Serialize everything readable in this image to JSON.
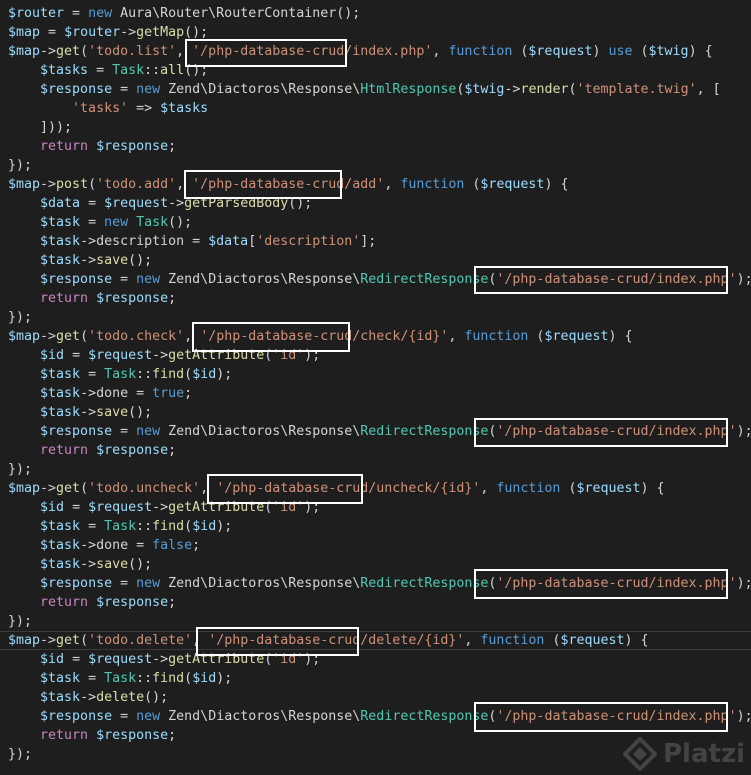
{
  "colors": {
    "background": "#1e1e1e",
    "variable": "#9cdcfe",
    "text": "#d4d4d4",
    "keyword": "#569cd6",
    "function": "#dcdcaa",
    "string": "#ce9178",
    "class": "#4ec9b0",
    "control": "#c586c0",
    "highlight_box": "#ffffff"
  },
  "watermark": {
    "icon": "platzi-logo-icon",
    "text": "Platzi"
  },
  "lines": [
    [
      [
        "var",
        "$router"
      ],
      [
        "txt",
        " = "
      ],
      [
        "kw",
        "new"
      ],
      [
        "txt",
        " Aura\\Router\\RouterContainer();"
      ]
    ],
    [
      [
        "var",
        "$map"
      ],
      [
        "txt",
        " = "
      ],
      [
        "var",
        "$router"
      ],
      [
        "txt",
        "->"
      ],
      [
        "fn",
        "getMap"
      ],
      [
        "txt",
        "();"
      ]
    ],
    [
      [
        "var",
        "$map"
      ],
      [
        "txt",
        "->"
      ],
      [
        "fn",
        "get"
      ],
      [
        "txt",
        "("
      ],
      [
        "str",
        "'todo.list'"
      ],
      [
        "txt",
        ", "
      ],
      [
        "str",
        "'/php-database-crud/index.php'"
      ],
      [
        "txt",
        ", "
      ],
      [
        "kw",
        "function"
      ],
      [
        "txt",
        " ("
      ],
      [
        "var",
        "$request"
      ],
      [
        "txt",
        ") "
      ],
      [
        "kw",
        "use"
      ],
      [
        "txt",
        " ("
      ],
      [
        "var",
        "$twig"
      ],
      [
        "txt",
        ") {"
      ]
    ],
    [
      [
        "txt",
        "    "
      ],
      [
        "var",
        "$tasks"
      ],
      [
        "txt",
        " = "
      ],
      [
        "cls",
        "Task"
      ],
      [
        "txt",
        "::"
      ],
      [
        "fn",
        "all"
      ],
      [
        "txt",
        "();"
      ]
    ],
    [
      [
        "txt",
        "    "
      ],
      [
        "var",
        "$response"
      ],
      [
        "txt",
        " = "
      ],
      [
        "kw",
        "new"
      ],
      [
        "txt",
        " Zend\\Diactoros\\Response\\"
      ],
      [
        "cls",
        "HtmlResponse"
      ],
      [
        "txt",
        "("
      ],
      [
        "var",
        "$twig"
      ],
      [
        "txt",
        "->"
      ],
      [
        "fn",
        "render"
      ],
      [
        "txt",
        "("
      ],
      [
        "str",
        "'template.twig'"
      ],
      [
        "txt",
        ", ["
      ]
    ],
    [
      [
        "txt",
        "        "
      ],
      [
        "str",
        "'tasks'"
      ],
      [
        "txt",
        " => "
      ],
      [
        "var",
        "$tasks"
      ]
    ],
    [
      [
        "txt",
        "    ]));"
      ]
    ],
    [
      [
        "txt",
        "    "
      ],
      [
        "ctl",
        "return"
      ],
      [
        "txt",
        " "
      ],
      [
        "var",
        "$response"
      ],
      [
        "txt",
        ";"
      ]
    ],
    [
      [
        "txt",
        "});"
      ]
    ],
    [
      [
        "var",
        "$map"
      ],
      [
        "txt",
        "->"
      ],
      [
        "fn",
        "post"
      ],
      [
        "txt",
        "("
      ],
      [
        "str",
        "'todo.add'"
      ],
      [
        "txt",
        ", "
      ],
      [
        "str",
        "'/php-database-crud/add'"
      ],
      [
        "txt",
        ", "
      ],
      [
        "kw",
        "function"
      ],
      [
        "txt",
        " ("
      ],
      [
        "var",
        "$request"
      ],
      [
        "txt",
        ") {"
      ]
    ],
    [
      [
        "txt",
        "    "
      ],
      [
        "var",
        "$data"
      ],
      [
        "txt",
        " = "
      ],
      [
        "var",
        "$request"
      ],
      [
        "txt",
        "->"
      ],
      [
        "fn",
        "getParsedBody"
      ],
      [
        "txt",
        "();"
      ]
    ],
    [
      [
        "txt",
        "    "
      ],
      [
        "var",
        "$task"
      ],
      [
        "txt",
        " = "
      ],
      [
        "kw",
        "new"
      ],
      [
        "txt",
        " "
      ],
      [
        "cls",
        "Task"
      ],
      [
        "txt",
        "();"
      ]
    ],
    [
      [
        "txt",
        "    "
      ],
      [
        "var",
        "$task"
      ],
      [
        "txt",
        "->description = "
      ],
      [
        "var",
        "$data"
      ],
      [
        "txt",
        "["
      ],
      [
        "str",
        "'description'"
      ],
      [
        "txt",
        "];"
      ]
    ],
    [
      [
        "txt",
        "    "
      ],
      [
        "var",
        "$task"
      ],
      [
        "txt",
        "->"
      ],
      [
        "fn",
        "save"
      ],
      [
        "txt",
        "();"
      ]
    ],
    [
      [
        "txt",
        "    "
      ],
      [
        "var",
        "$response"
      ],
      [
        "txt",
        " = "
      ],
      [
        "kw",
        "new"
      ],
      [
        "txt",
        " Zend\\Diactoros\\Response\\"
      ],
      [
        "cls",
        "RedirectResponse"
      ],
      [
        "txt",
        "("
      ],
      [
        "str",
        "'/php-database-crud/index.php'"
      ],
      [
        "txt",
        ");"
      ]
    ],
    [
      [
        "txt",
        "    "
      ],
      [
        "ctl",
        "return"
      ],
      [
        "txt",
        " "
      ],
      [
        "var",
        "$response"
      ],
      [
        "txt",
        ";"
      ]
    ],
    [
      [
        "txt",
        "});"
      ]
    ],
    [
      [
        "var",
        "$map"
      ],
      [
        "txt",
        "->"
      ],
      [
        "fn",
        "get"
      ],
      [
        "txt",
        "("
      ],
      [
        "str",
        "'todo.check'"
      ],
      [
        "txt",
        ", "
      ],
      [
        "str",
        "'/php-database-crud/check/{id}'"
      ],
      [
        "txt",
        ", "
      ],
      [
        "kw",
        "function"
      ],
      [
        "txt",
        " ("
      ],
      [
        "var",
        "$request"
      ],
      [
        "txt",
        ") {"
      ]
    ],
    [
      [
        "txt",
        "    "
      ],
      [
        "var",
        "$id"
      ],
      [
        "txt",
        " = "
      ],
      [
        "var",
        "$request"
      ],
      [
        "txt",
        "->"
      ],
      [
        "fn",
        "getAttribute"
      ],
      [
        "txt",
        "("
      ],
      [
        "str",
        "'id'"
      ],
      [
        "txt",
        ");"
      ]
    ],
    [
      [
        "txt",
        "    "
      ],
      [
        "var",
        "$task"
      ],
      [
        "txt",
        " = "
      ],
      [
        "cls",
        "Task"
      ],
      [
        "txt",
        "::"
      ],
      [
        "fn",
        "find"
      ],
      [
        "txt",
        "("
      ],
      [
        "var",
        "$id"
      ],
      [
        "txt",
        ");"
      ]
    ],
    [
      [
        "txt",
        "    "
      ],
      [
        "var",
        "$task"
      ],
      [
        "txt",
        "->done = "
      ],
      [
        "kw",
        "true"
      ],
      [
        "txt",
        ";"
      ]
    ],
    [
      [
        "txt",
        "    "
      ],
      [
        "var",
        "$task"
      ],
      [
        "txt",
        "->"
      ],
      [
        "fn",
        "save"
      ],
      [
        "txt",
        "();"
      ]
    ],
    [
      [
        "txt",
        "    "
      ],
      [
        "var",
        "$response"
      ],
      [
        "txt",
        " = "
      ],
      [
        "kw",
        "new"
      ],
      [
        "txt",
        " Zend\\Diactoros\\Response\\"
      ],
      [
        "cls",
        "RedirectResponse"
      ],
      [
        "txt",
        "("
      ],
      [
        "str",
        "'/php-database-crud/index.php'"
      ],
      [
        "txt",
        ");"
      ]
    ],
    [
      [
        "txt",
        "    "
      ],
      [
        "ctl",
        "return"
      ],
      [
        "txt",
        " "
      ],
      [
        "var",
        "$response"
      ],
      [
        "txt",
        ";"
      ]
    ],
    [
      [
        "txt",
        "});"
      ]
    ],
    [
      [
        "var",
        "$map"
      ],
      [
        "txt",
        "->"
      ],
      [
        "fn",
        "get"
      ],
      [
        "txt",
        "("
      ],
      [
        "str",
        "'todo.uncheck'"
      ],
      [
        "txt",
        ", "
      ],
      [
        "str",
        "'/php-database-crud/uncheck/{id}'"
      ],
      [
        "txt",
        ", "
      ],
      [
        "kw",
        "function"
      ],
      [
        "txt",
        " ("
      ],
      [
        "var",
        "$request"
      ],
      [
        "txt",
        ") {"
      ]
    ],
    [
      [
        "txt",
        "    "
      ],
      [
        "var",
        "$id"
      ],
      [
        "txt",
        " = "
      ],
      [
        "var",
        "$request"
      ],
      [
        "txt",
        "->"
      ],
      [
        "fn",
        "getAttribute"
      ],
      [
        "txt",
        "("
      ],
      [
        "str",
        "'id'"
      ],
      [
        "txt",
        ");"
      ]
    ],
    [
      [
        "txt",
        "    "
      ],
      [
        "var",
        "$task"
      ],
      [
        "txt",
        " = "
      ],
      [
        "cls",
        "Task"
      ],
      [
        "txt",
        "::"
      ],
      [
        "fn",
        "find"
      ],
      [
        "txt",
        "("
      ],
      [
        "var",
        "$id"
      ],
      [
        "txt",
        ");"
      ]
    ],
    [
      [
        "txt",
        "    "
      ],
      [
        "var",
        "$task"
      ],
      [
        "txt",
        "->done = "
      ],
      [
        "kw",
        "false"
      ],
      [
        "txt",
        ";"
      ]
    ],
    [
      [
        "txt",
        "    "
      ],
      [
        "var",
        "$task"
      ],
      [
        "txt",
        "->"
      ],
      [
        "fn",
        "save"
      ],
      [
        "txt",
        "();"
      ]
    ],
    [
      [
        "txt",
        "    "
      ],
      [
        "var",
        "$response"
      ],
      [
        "txt",
        " = "
      ],
      [
        "kw",
        "new"
      ],
      [
        "txt",
        " Zend\\Diactoros\\Response\\"
      ],
      [
        "cls",
        "RedirectResponse"
      ],
      [
        "txt",
        "("
      ],
      [
        "str",
        "'/php-database-crud/index.php'"
      ],
      [
        "txt",
        ");"
      ]
    ],
    [
      [
        "txt",
        "    "
      ],
      [
        "ctl",
        "return"
      ],
      [
        "txt",
        " "
      ],
      [
        "var",
        "$response"
      ],
      [
        "txt",
        ";"
      ]
    ],
    [
      [
        "txt",
        "});"
      ]
    ],
    [
      [
        "var",
        "$map"
      ],
      [
        "txt",
        "->"
      ],
      [
        "fn",
        "get"
      ],
      [
        "txt",
        "("
      ],
      [
        "str",
        "'todo.delete'"
      ],
      [
        "txt",
        ", "
      ],
      [
        "str",
        "'/php-database-crud/delete/{id}'"
      ],
      [
        "txt",
        ", "
      ],
      [
        "kw",
        "function"
      ],
      [
        "txt",
        " ("
      ],
      [
        "var",
        "$request"
      ],
      [
        "txt",
        ") {"
      ]
    ],
    [
      [
        "txt",
        "    "
      ],
      [
        "var",
        "$id"
      ],
      [
        "txt",
        " = "
      ],
      [
        "var",
        "$request"
      ],
      [
        "txt",
        "->"
      ],
      [
        "fn",
        "getAttribute"
      ],
      [
        "txt",
        "("
      ],
      [
        "str",
        "'id'"
      ],
      [
        "txt",
        ");"
      ]
    ],
    [
      [
        "txt",
        "    "
      ],
      [
        "var",
        "$task"
      ],
      [
        "txt",
        " = "
      ],
      [
        "cls",
        "Task"
      ],
      [
        "txt",
        "::"
      ],
      [
        "fn",
        "find"
      ],
      [
        "txt",
        "("
      ],
      [
        "var",
        "$id"
      ],
      [
        "txt",
        ");"
      ]
    ],
    [
      [
        "txt",
        "    "
      ],
      [
        "var",
        "$task"
      ],
      [
        "txt",
        "->"
      ],
      [
        "fn",
        "delete"
      ],
      [
        "txt",
        "();"
      ]
    ],
    [
      [
        "txt",
        "    "
      ],
      [
        "var",
        "$response"
      ],
      [
        "txt",
        " = "
      ],
      [
        "kw",
        "new"
      ],
      [
        "txt",
        " Zend\\Diactoros\\Response\\"
      ],
      [
        "cls",
        "RedirectResponse"
      ],
      [
        "txt",
        "("
      ],
      [
        "str",
        "'/php-database-crud/index.php'"
      ],
      [
        "txt",
        ");"
      ]
    ],
    [
      [
        "txt",
        "    "
      ],
      [
        "ctl",
        "return"
      ],
      [
        "txt",
        " "
      ],
      [
        "var",
        "$response"
      ],
      [
        "txt",
        ";"
      ]
    ],
    [
      [
        "txt",
        "});"
      ]
    ]
  ]
}
